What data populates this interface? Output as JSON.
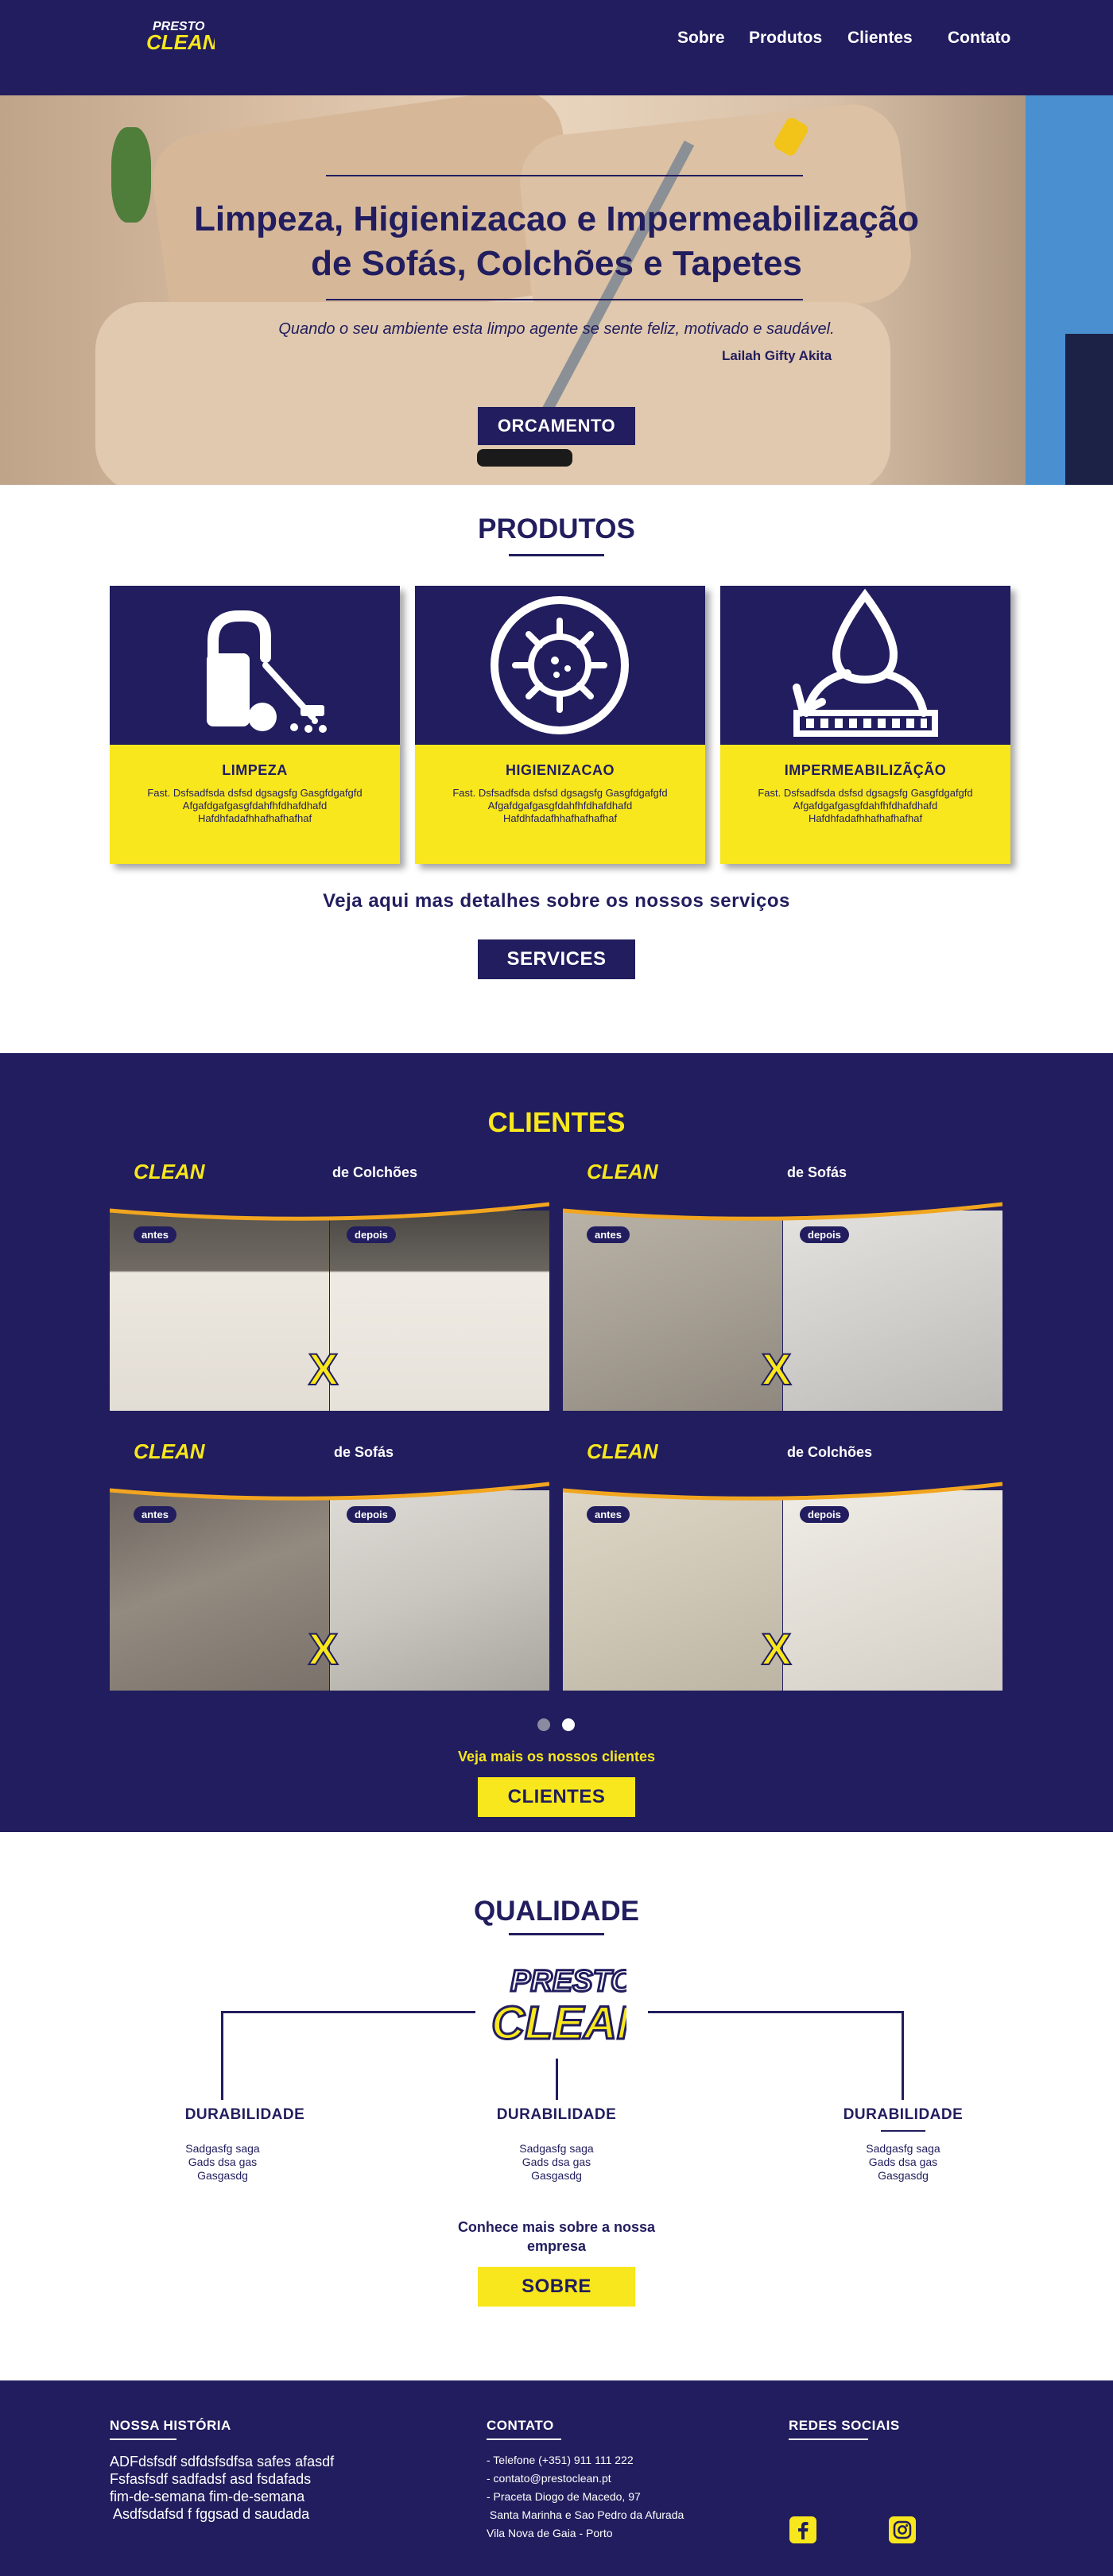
{
  "colors": {
    "navy": "#211d5e",
    "yellow": "#f8e71c",
    "white": "#ffffff"
  },
  "brand": {
    "line1": "PRESTO",
    "line2": "CLEAN"
  },
  "nav": {
    "items": [
      "Sobre",
      "Produtos",
      "Clientes",
      "Contato"
    ]
  },
  "hero": {
    "title_line1": "Limpeza, Higienizacao e Impermeabilização",
    "title_line2": "de Sofás, Colchões e Tapetes",
    "quote": "Quando o seu ambiente esta limpo agente se sente feliz, motivado e saudável.",
    "author": "Lailah Gifty Akita",
    "button": "ORCAMENTO"
  },
  "produtos": {
    "title": "PRODUTOS",
    "cards": [
      {
        "icon": "vacuum-cleaner-icon",
        "title": "LIMPEZA",
        "text": "Fast. Dsfsadfsda dsfsd dgsagsfg Gasgfdgafgfd Afgafdgafgasgfdahfhfdhafdhafd Hafdhfadafhhafhafhafhaf"
      },
      {
        "icon": "virus-shield-icon",
        "title": "HIGIENIZACAO",
        "text": "Fast. Dsfsadfsda dsfsd dgsagsfg Gasgfdgafgfd Afgafdgafgasgfdahfhfdhafdhafd Hafdhfadafhhafhafhafhaf"
      },
      {
        "icon": "water-drop-fabric-icon",
        "title": "IMPERMEABILIZÃÇÃO",
        "text": "Fast. Dsfsadfsda dsfsd dgsagsfg Gasgfdgafgfd Afgafdgafgasgfdahfhfdhafdhafd Hafdhfadafhhafhafhafhaf"
      }
    ],
    "details_text": "Veja aqui mas detalhes sobre os nossos serviços",
    "button": "SERVICES"
  },
  "clientes": {
    "title": "CLIENTES",
    "photos": [
      {
        "heading": "de Colchões",
        "before": "antes",
        "after": "depois",
        "x": "X"
      },
      {
        "heading": "de Sofás",
        "before": "antes",
        "after": "depois",
        "x": "X"
      },
      {
        "heading": "de Sofás",
        "before": "antes",
        "after": "depois",
        "x": "X"
      },
      {
        "heading": "de Colchões",
        "before": "antes",
        "after": "depois",
        "x": "X"
      }
    ],
    "more_text": "Veja mais os nossos clientes",
    "button": "CLIENTES"
  },
  "qualidade": {
    "title": "QUALIDADE",
    "items": [
      {
        "title": "DURABILIDADE",
        "line1": "Sadgasfg saga",
        "line2": "Gads dsa gas",
        "line3": "Gasgasdg"
      },
      {
        "title": "DURABILIDADE",
        "line1": "Sadgasfg saga",
        "line2": "Gads dsa gas",
        "line3": "Gasgasdg"
      },
      {
        "title": "DURABILIDADE",
        "line1": "Sadgasfg saga",
        "line2": "Gads dsa gas",
        "line3": "Gasgasdg"
      }
    ],
    "about_line1": "Conhece mais sobre a nossa",
    "about_line2": "empresa",
    "button": "SOBRE"
  },
  "footer": {
    "historia_title": "NOSSA HISTÓRIA",
    "historia_lines": [
      "ADFdsfsdf sdfdsfsdfsa safes afasdf",
      "Fsfasfsdf sadfadsf asd fsdafads",
      "fim-de-semana fim-de-semana",
      " Asdfsdafsd f fggsad d saudada"
    ],
    "contato_title": "CONTATO",
    "contato_lines": [
      "- Telefone (+351) 911 111 222",
      "- contato@prestoclean.pt",
      "- Praceta Diogo de Macedo, 97",
      " Santa Marinha e Sao Pedro da Afurada",
      "Vila Nova de Gaia - Porto"
    ],
    "redes_title": "REDES SOCIAIS",
    "social": [
      "facebook-icon",
      "instagram-icon"
    ]
  }
}
